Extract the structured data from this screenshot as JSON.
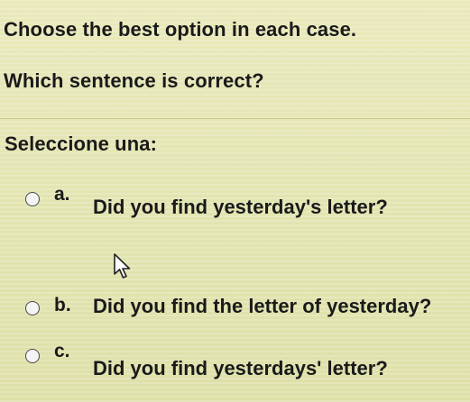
{
  "header": {
    "instruction": "Choose the best option in each case.",
    "question": "Which sentence is correct?"
  },
  "prompt": "Seleccione una:",
  "options": [
    {
      "letter": "a.",
      "text": "Did you find yesterday's letter?"
    },
    {
      "letter": "b.",
      "text": "Did you find the letter of yesterday?"
    },
    {
      "letter": "c.",
      "text": "Did you find yesterdays' letter?"
    }
  ],
  "cursor_icon": "mouse-pointer-icon"
}
